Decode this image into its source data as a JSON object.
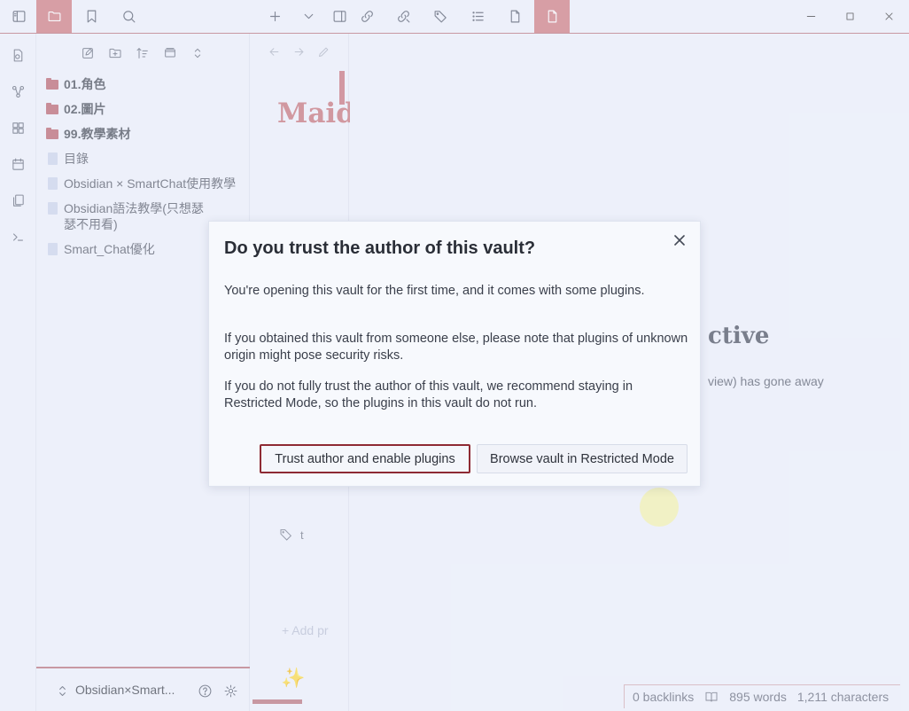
{
  "app": {
    "accent": "#cc7479",
    "bg": "#eef2fb"
  },
  "topbar": {
    "icons": [
      "sidebar-toggle-icon",
      "folder-icon",
      "bookmark-icon",
      "search-icon",
      "new-tab-icon",
      "chevron-down-icon",
      "split-panel-icon",
      "link-in-icon",
      "link-out-icon",
      "tags-icon",
      "list-icon",
      "file-icon",
      "file-active-icon"
    ],
    "window_controls": [
      "minimize-icon",
      "maximize-icon",
      "close-icon"
    ]
  },
  "ribbon": {
    "icons": [
      "open-quick-switcher-icon",
      "graph-view-icon",
      "canvas-icon",
      "daily-note-icon",
      "templates-icon",
      "command-palette-icon"
    ]
  },
  "explorer": {
    "tools": [
      "new-note-icon",
      "new-folder-icon",
      "sort-icon",
      "collapse-icon",
      "expand-icon"
    ],
    "items": [
      {
        "type": "folder",
        "label": "01.角色"
      },
      {
        "type": "folder",
        "label": "02.圖片"
      },
      {
        "type": "folder",
        "label": "99.教學素材"
      },
      {
        "type": "file",
        "label": "目錄"
      },
      {
        "type": "file",
        "label": "Obsidian × SmartChat使用教學"
      },
      {
        "type": "file",
        "label": "Obsidian語法教學(只想瑟瑟不用看)"
      },
      {
        "type": "file",
        "label": "Smart_Chat優化"
      }
    ],
    "vault_name": "Obsidian×Smart..."
  },
  "editor": {
    "title": "Maid",
    "tag_text": "t",
    "add_property": "+ Add pr",
    "sparkle": "✨"
  },
  "right": {
    "heading_fragment": "ctive",
    "text_fragment": "view) has gone away"
  },
  "status_bar": {
    "backlinks": "0 backlinks",
    "words": "895 words",
    "characters": "1,211 characters"
  },
  "modal": {
    "title": "Do you trust the author of this vault?",
    "p1": "You're opening this vault for the first time, and it comes with some plugins.",
    "p2": "If you obtained this vault from someone else, please note that plugins of unknown origin might pose security risks.",
    "p3": "If you do not fully trust the author of this vault, we recommend staying in Restricted Mode, so the plugins in this vault do not run.",
    "primary_button": "Trust author and enable plugins",
    "secondary_button": "Browse vault in Restricted Mode"
  }
}
